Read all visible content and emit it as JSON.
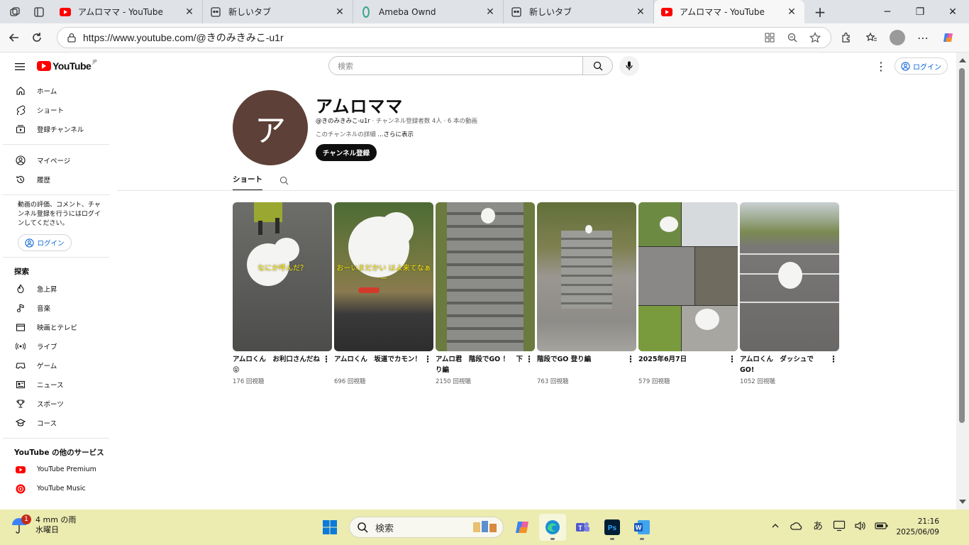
{
  "browser": {
    "tabs": [
      {
        "label": "アムロママ - YouTube",
        "favicon": "youtube-icon",
        "active": false
      },
      {
        "label": "新しいタブ",
        "favicon": "newtab-icon",
        "active": false
      },
      {
        "label": "Ameba Ownd",
        "favicon": "ameba-icon",
        "active": false
      },
      {
        "label": "新しいタブ",
        "favicon": "newtab-icon",
        "active": false
      },
      {
        "label": "アムロママ - YouTube",
        "favicon": "youtube-icon",
        "active": true
      }
    ],
    "url": "https://www.youtube.com/@きのみきみこ-u1r"
  },
  "youtube": {
    "logo_text": "YouTube",
    "logo_region": "JP",
    "search_placeholder": "検索",
    "login_label": "ログイン"
  },
  "sidebar": {
    "main": [
      {
        "label": "ホーム",
        "icon": "home-icon"
      },
      {
        "label": "ショート",
        "icon": "shorts-icon"
      },
      {
        "label": "登録チャンネル",
        "icon": "subscriptions-icon"
      }
    ],
    "you": [
      {
        "label": "マイページ",
        "icon": "user-icon"
      },
      {
        "label": "履歴",
        "icon": "history-icon"
      }
    ],
    "signin_note": "動画の評価、コメント、チャンネル登録を行うにはログインしてください。",
    "signin_label": "ログイン",
    "explore_heading": "探索",
    "explore": [
      {
        "label": "急上昇",
        "icon": "trending-icon"
      },
      {
        "label": "音楽",
        "icon": "music-icon"
      },
      {
        "label": "映画とテレビ",
        "icon": "movie-icon"
      },
      {
        "label": "ライブ",
        "icon": "live-icon"
      },
      {
        "label": "ゲーム",
        "icon": "gaming-icon"
      },
      {
        "label": "ニュース",
        "icon": "news-icon"
      },
      {
        "label": "スポーツ",
        "icon": "trophy-icon"
      },
      {
        "label": "コース",
        "icon": "course-icon"
      }
    ],
    "more_heading": "YouTube の他のサービス",
    "more": [
      {
        "label": "YouTube Premium",
        "icon": "yt-premium-icon"
      },
      {
        "label": "YouTube Music",
        "icon": "yt-music-icon"
      }
    ]
  },
  "channel": {
    "avatar_letter": "ア",
    "avatar_color": "#5d4037",
    "name": "アムロママ",
    "handle": "@きのみきみこ-u1r",
    "meta": " · チャンネル登録者数 4人 · 6 本の動画",
    "desc_prefix": "このチャンネルの詳細 ",
    "desc_more": "...さらに表示",
    "subscribe_label": "チャンネル登録",
    "tab_label": "ショート"
  },
  "videos": [
    {
      "title": "アムロくん　お利口さんだね😝",
      "views": "176 回視聴",
      "overlay": "なにか呼んだ？"
    },
    {
      "title": "アムロくん　坂道でカモン！",
      "views": "696 回視聴",
      "overlay": "おーいまだかい はよ来てなぁー"
    },
    {
      "title": "アムロ君　階段でGO ！　下り編",
      "views": "2150 回視聴",
      "overlay": ""
    },
    {
      "title": "階段でGO 登り編",
      "views": "763 回視聴",
      "overlay": ""
    },
    {
      "title": "2025年6月7日",
      "views": "579 回視聴",
      "overlay": ""
    },
    {
      "title": "アムロくん　ダッシュでGO!",
      "views": "1052 回視聴",
      "overlay": ""
    }
  ],
  "taskbar": {
    "weather_badge": "1",
    "weather_line1": "4 mm の雨",
    "weather_line2": "水曜日",
    "search_label": "検索",
    "ime": "あ",
    "time": "21:16",
    "date": "2025/06/09"
  }
}
